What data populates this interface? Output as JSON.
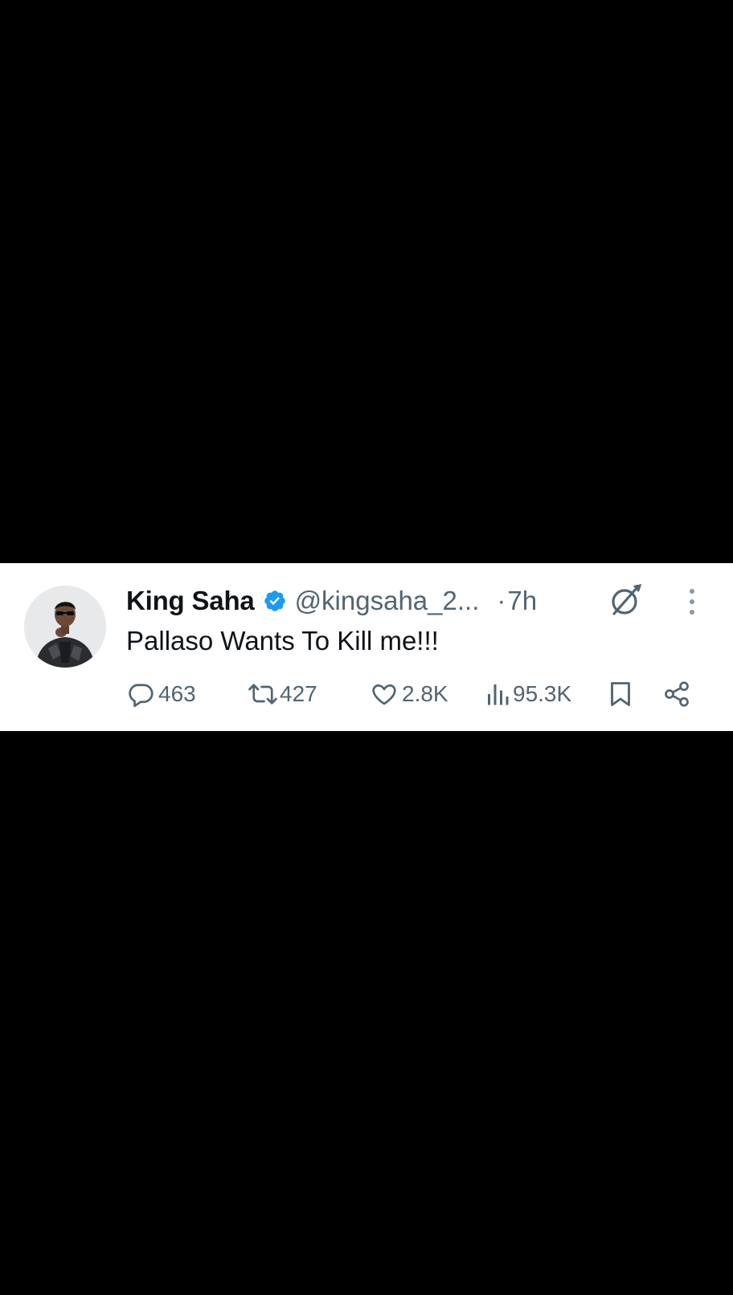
{
  "tweet": {
    "display_name": "King Saha",
    "handle": "@kingsaha_2...",
    "separator": "·",
    "time": "7h",
    "text": "Pallaso Wants To Kill me!!!",
    "replies": "463",
    "reposts": "427",
    "likes": "2.8K",
    "views": "95.3K"
  },
  "icons": {
    "verified": "verified-badge-icon",
    "grok": "grok-icon",
    "more": "more-vertical-icon",
    "reply": "reply-icon",
    "repost": "repost-icon",
    "like": "heart-icon",
    "views": "views-icon",
    "bookmark": "bookmark-icon",
    "share": "share-icon"
  },
  "colors": {
    "background": "#000000",
    "card": "#ffffff",
    "text_primary": "#0f1419",
    "text_secondary": "#536471",
    "verified": "#1d9bf0"
  }
}
